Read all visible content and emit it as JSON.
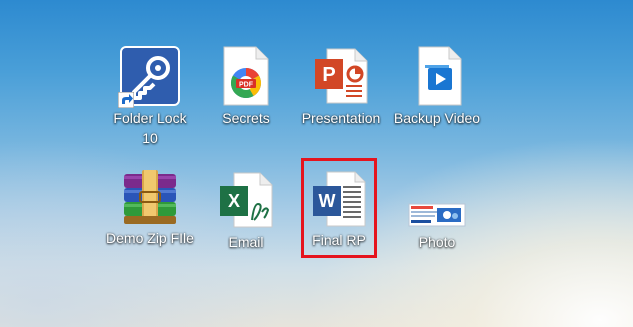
{
  "desktop": {
    "icons": [
      {
        "label": "Folder Lock 10",
        "icon": "key-icon"
      },
      {
        "label": "Secrets",
        "icon": "pdf-file-icon"
      },
      {
        "label": "Presentation",
        "icon": "powerpoint-file-icon"
      },
      {
        "label": "Backup Video",
        "icon": "video-file-icon"
      },
      {
        "label": "Demo Zip FIle",
        "icon": "winrar-archive-icon"
      },
      {
        "label": "Email",
        "icon": "excel-file-icon"
      },
      {
        "label": "Final RP",
        "icon": "word-file-icon"
      },
      {
        "label": "Photo",
        "icon": "image-file-icon"
      }
    ],
    "selected": "Final RP",
    "colors": {
      "selection": "#e5141e",
      "folder_lock": "#2f5dae",
      "powerpoint": "#d24726",
      "excel": "#1e7145",
      "word": "#2b579a",
      "video": "#1976d2"
    }
  },
  "pdf_badge": "PDF",
  "word_letter": "W",
  "excel_letter": "X",
  "ppt_letter": "P"
}
